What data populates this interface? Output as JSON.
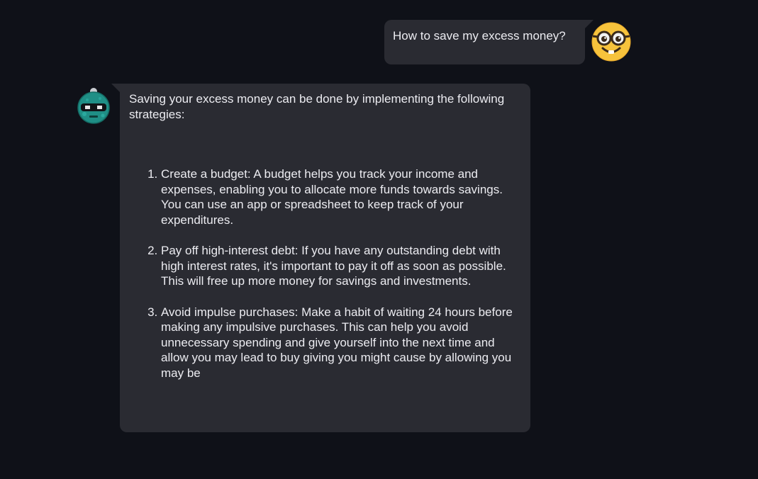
{
  "conversation": {
    "user_message": {
      "text": "How to save my excess money?",
      "avatar_icon": "nerd-face-emoji-icon"
    },
    "bot_message": {
      "avatar_icon": "robot-avatar-icon",
      "intro": "Saving your excess money can be done by implementing the following strategies:",
      "items": [
        "Create a budget: A budget helps you track your income and expenses, enabling you to allocate more funds towards savings. You can use an app or spreadsheet to keep track of your expenditures.",
        "Pay off high-interest debt: If you have any outstanding debt with high interest rates, it's important to pay it off as soon as possible. This will free up more money for savings and investments.",
        "Avoid impulse purchases: Make a habit of waiting 24 hours before making any impulsive purchases. This can help you avoid unnecessary spending and give yourself into the next time and allow you may lead to buy giving you might cause by allowing you may be"
      ]
    }
  },
  "colors": {
    "background": "#0f1118",
    "bubble": "#2a2b32",
    "text": "#ececf1",
    "emoji_yellow": "#f7c33c",
    "robot_teal": "#1f8f86"
  }
}
